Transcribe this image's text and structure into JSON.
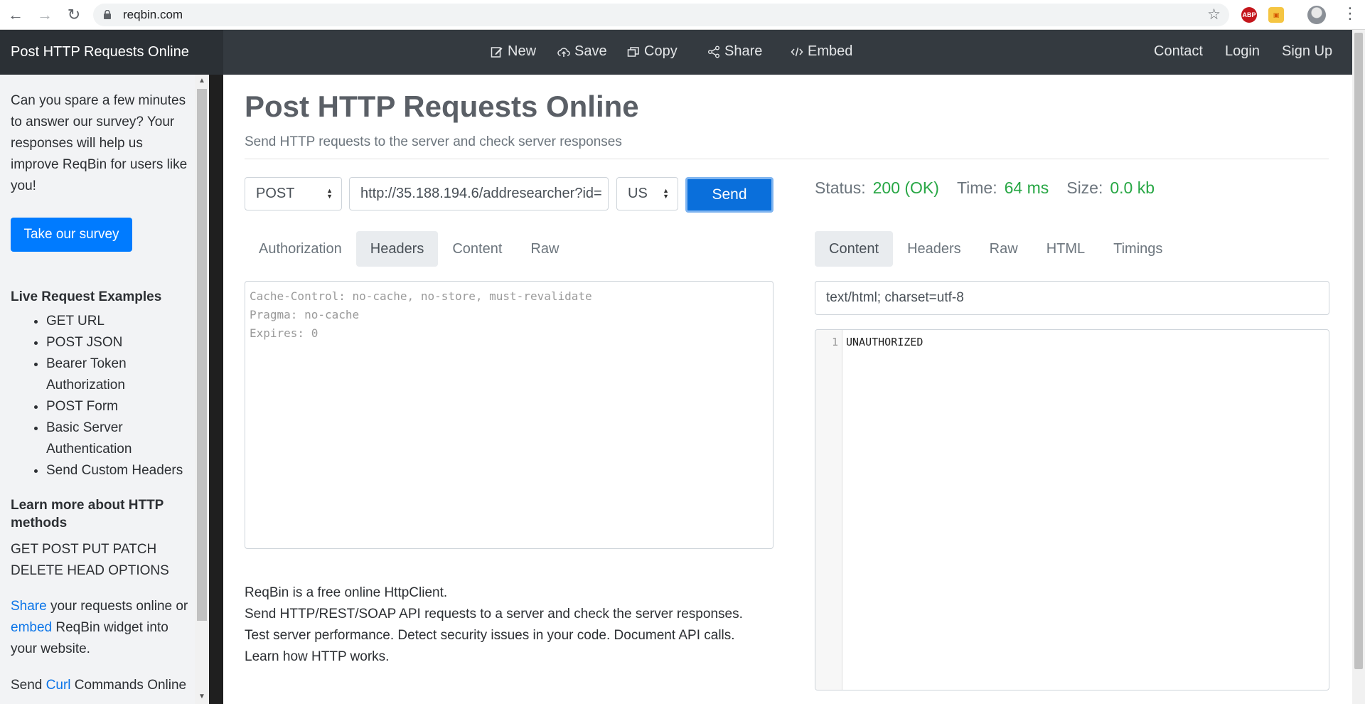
{
  "browser": {
    "url": "reqbin.com",
    "back_icon": "arrow-left",
    "forward_icon": "arrow-right",
    "reload_icon": "reload",
    "extensions": [
      "ABP"
    ]
  },
  "navbar": {
    "brand": "Post HTTP Requests Online",
    "actions": {
      "new": "New",
      "save": "Save",
      "copy": "Copy",
      "share": "Share",
      "embed": "Embed"
    },
    "right": {
      "contact": "Contact",
      "login": "Login",
      "signup": "Sign Up"
    }
  },
  "sidebar": {
    "survey_text": "Can you spare a few minutes to answer our survey? Your responses will help us improve ReqBin for users like you!",
    "survey_button": "Take our survey",
    "examples_heading": "Live Request Examples",
    "examples": [
      "GET URL",
      "POST JSON",
      "Bearer Token Authorization",
      "POST Form",
      "Basic Server Authentication",
      "Send Custom Headers"
    ],
    "methods_heading": "Learn more about HTTP methods",
    "methods_line1": "GET POST PUT PATCH",
    "methods_line2": "DELETE HEAD OPTIONS",
    "share_link": "Share",
    "share_text1": " your requests online or ",
    "embed_link": "embed",
    "share_text2": " ReqBin widget into your website.",
    "curl_prefix": "Send ",
    "curl_link": "Curl",
    "curl_suffix": " Commands Online"
  },
  "main": {
    "title": "Post HTTP Requests Online",
    "subtitle": "Send HTTP requests to the server and check server responses",
    "method": "POST",
    "url_value": "http://35.188.194.6/addresearcher?id=",
    "region": "US",
    "send": "Send",
    "request_tabs": [
      "Authorization",
      "Headers",
      "Content",
      "Raw"
    ],
    "request_active_tab": "Headers",
    "headers_text": "Cache-Control: no-cache, no-store, must-revalidate\nPragma: no-cache\nExpires: 0",
    "about": [
      "ReqBin is a free online HttpClient.",
      "Send HTTP/REST/SOAP API requests to a server and check the server responses.",
      "Test server performance. Detect security issues in your code. Document API calls.",
      "Learn how HTTP works."
    ]
  },
  "response": {
    "status_label": "Status:",
    "status_value": "200 (OK)",
    "time_label": "Time:",
    "time_value": "64 ms",
    "size_label": "Size:",
    "size_value": "0.0 kb",
    "tabs": [
      "Content",
      "Headers",
      "Raw",
      "HTML",
      "Timings"
    ],
    "active_tab": "Content",
    "content_type": "text/html; charset=utf-8",
    "line_number": "1",
    "body": "UNAUTHORIZED"
  },
  "colors": {
    "navbar": "#343a40",
    "primary": "#007bff",
    "success": "#28a745",
    "sidebar": "#f2f3f5"
  }
}
